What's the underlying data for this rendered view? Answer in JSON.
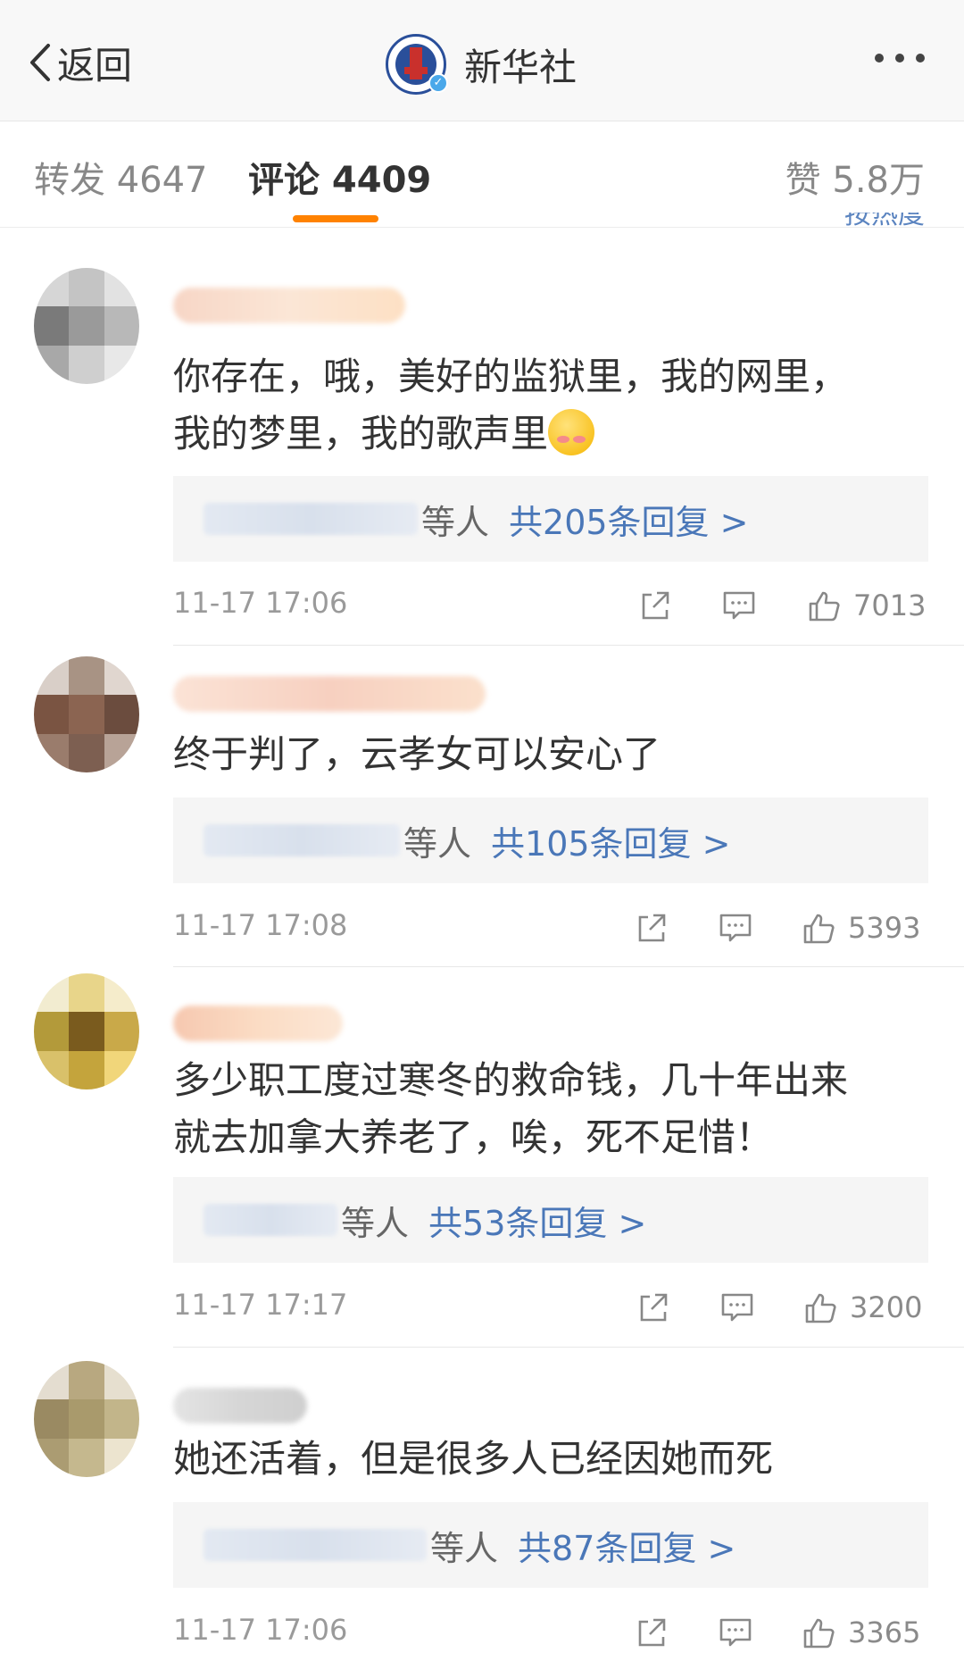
{
  "header": {
    "back_label": "返回",
    "title": "新华社",
    "logo_icon": "xinhua-logo",
    "more_icon": "more-dots-icon"
  },
  "tabs": [
    {
      "label": "转发 4647",
      "active": false
    },
    {
      "label": "评论 4409",
      "active": true
    },
    {
      "label": "赞 5.8万",
      "active": false
    }
  ],
  "sort_fragment": "按热度",
  "colors": {
    "accent": "#ff8200",
    "link": "#4a77b8",
    "verified": "#4aa8ea"
  },
  "comments": [
    {
      "text_line1": "你存在，哦，美好的监狱里，我的网里，",
      "text_line2": "我的梦里，我的歌声里",
      "has_emoji": true,
      "reply_suffix": "等人",
      "reply_link": "共205条回复 >",
      "time": "11-17 17:06",
      "likes": "7013"
    },
    {
      "text_line1": "终于判了，云孝女可以安心了",
      "text_line2": "",
      "has_emoji": false,
      "reply_suffix": "等人",
      "reply_link": "共105条回复 >",
      "time": "11-17 17:08",
      "likes": "5393"
    },
    {
      "text_line1": "多少职工度过寒冬的救命钱，几十年出来",
      "text_line2": "就去加拿大养老了，唉，死不足惜！",
      "has_emoji": false,
      "reply_suffix": "等人",
      "reply_link": "共53条回复 >",
      "time": "11-17 17:17",
      "likes": "3200"
    },
    {
      "text_line1": "她还活着，但是很多人已经因她而死",
      "text_line2": "",
      "has_emoji": false,
      "reply_suffix": "等人",
      "reply_link": "共87条回复 >",
      "time": "11-17 17:06",
      "likes": "3365"
    }
  ]
}
